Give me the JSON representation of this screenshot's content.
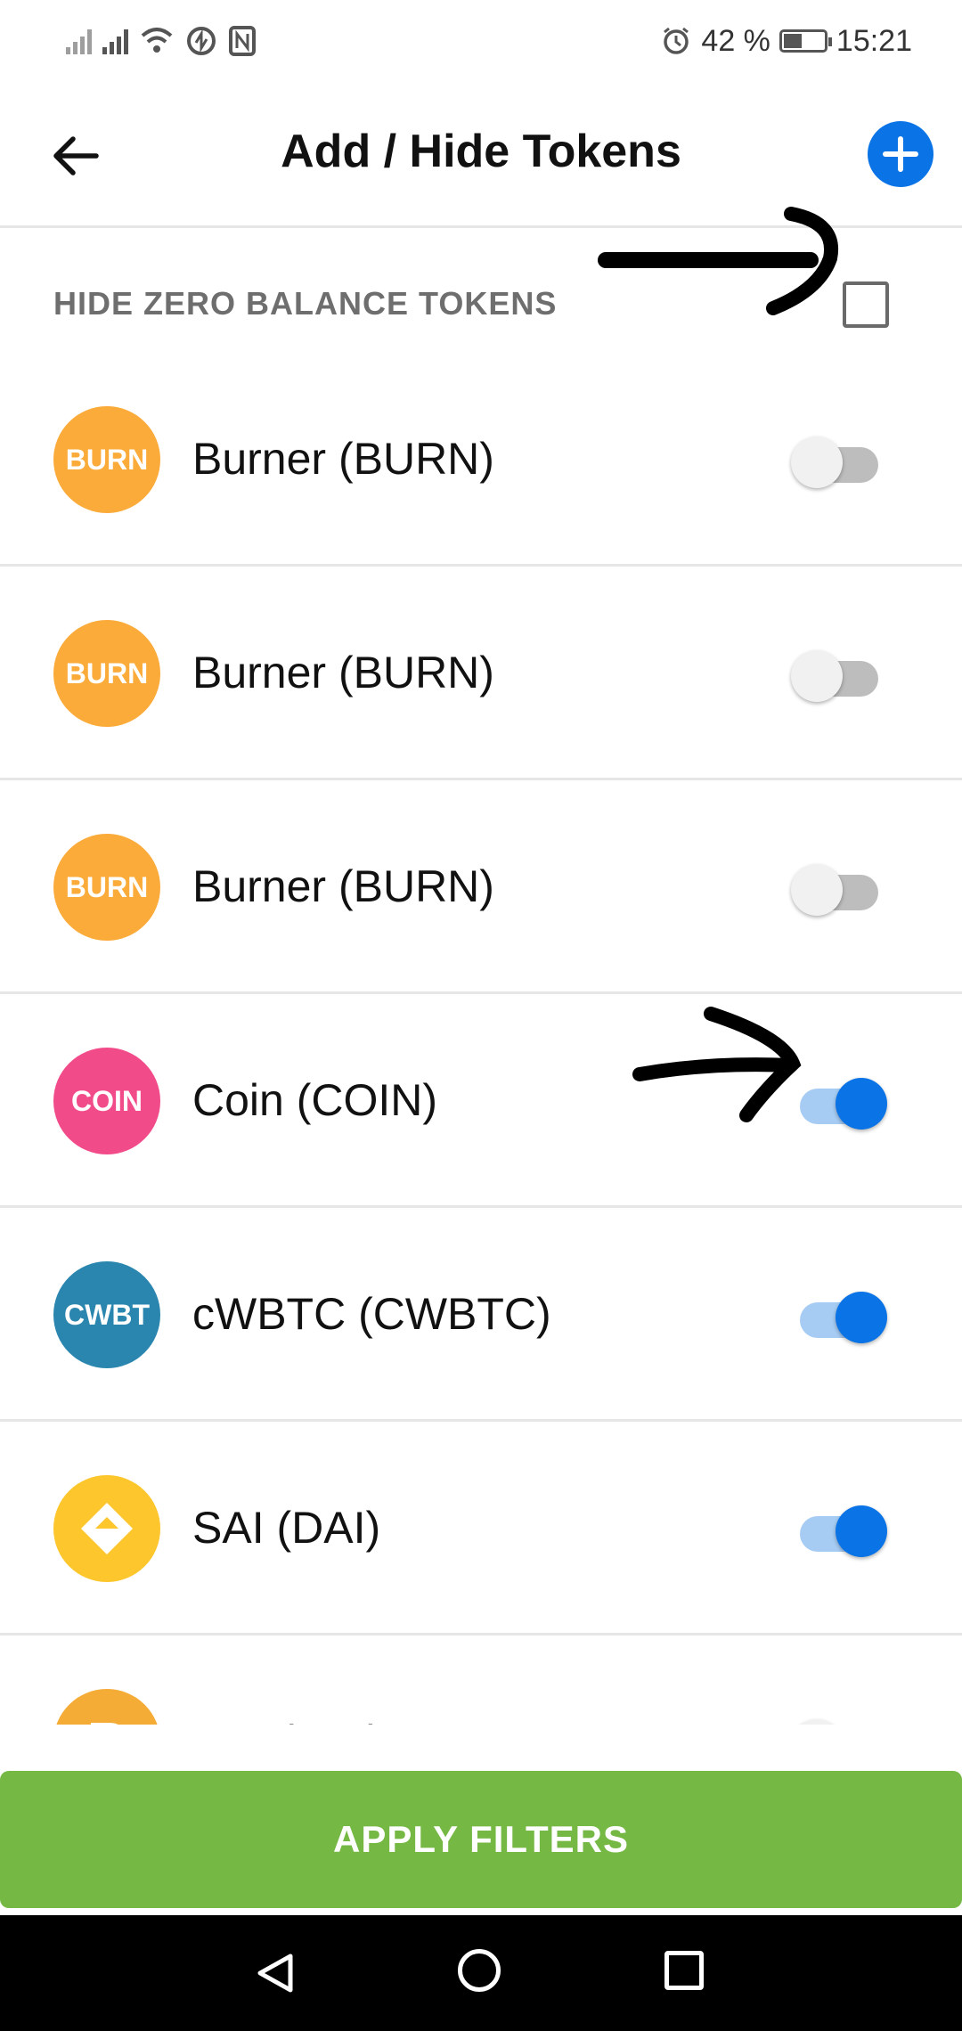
{
  "status_bar": {
    "alarm_icon": "alarm-icon",
    "battery_percent": "42 %",
    "time": "15:21"
  },
  "header": {
    "title": "Add / Hide Tokens",
    "back_icon": "arrow-left-icon",
    "add_icon": "plus-circle-icon"
  },
  "filters": {
    "hide_zero_balance_label": "HIDE ZERO BALANCE TOKENS",
    "hide_zero_balance_checked": false
  },
  "tokens": [
    {
      "icon_text": "BURN",
      "icon_color": "#fbab3a",
      "name": "Burner (BURN)",
      "enabled": false
    },
    {
      "icon_text": "BURN",
      "icon_color": "#fbab3a",
      "name": "Burner (BURN)",
      "enabled": false
    },
    {
      "icon_text": "BURN",
      "icon_color": "#fbab3a",
      "name": "Burner (BURN)",
      "enabled": false
    },
    {
      "icon_text": "COIN",
      "icon_color": "#f24b8a",
      "name": "Coin (COIN)",
      "enabled": true
    },
    {
      "icon_text": "CWBT",
      "icon_color": "#2a86ae",
      "name": "cWBTC (CWBTC)",
      "enabled": true
    },
    {
      "icon_text": "",
      "icon_color": "#fcc62c",
      "name": "SAI (DAI)",
      "enabled": true
    },
    {
      "icon_text": "",
      "icon_color": "#f5ac37",
      "name": "DAI (DAI)",
      "enabled": false
    }
  ],
  "apply_button": {
    "label": "APPLY FILTERS"
  },
  "colors": {
    "accent": "#0a74e6",
    "apply_green": "#75b844"
  }
}
